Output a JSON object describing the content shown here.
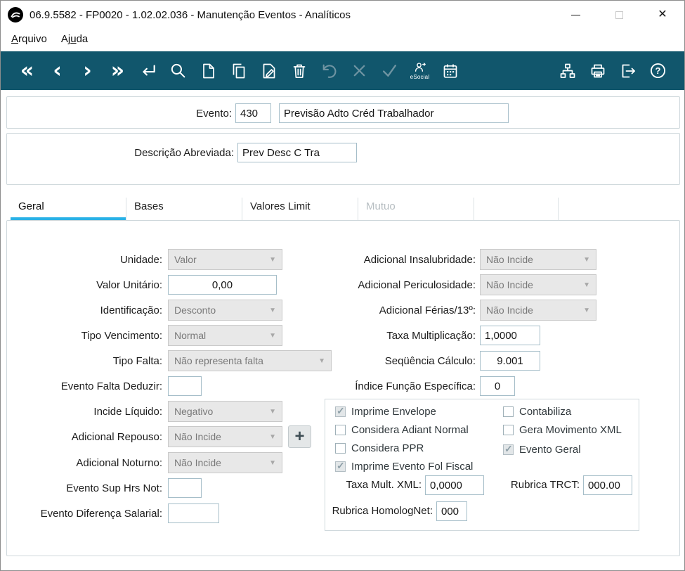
{
  "window": {
    "title": "06.9.5582 - FP0020 - 1.02.02.036 - Manutenção Eventos - Analíticos"
  },
  "menu": {
    "arquivo_key": "A",
    "arquivo_post": "rquivo",
    "ajuda_pre": "Aj",
    "ajuda_key": "u",
    "ajuda_post": "da"
  },
  "toolbar": {
    "esocial_label": "eSocial",
    "buttons_left": [
      "first-record",
      "previous-record",
      "next-record",
      "last-record",
      "confirm",
      "search",
      "new-document",
      "copy-document",
      "edit-document",
      "delete",
      "undo",
      "cancel",
      "ok",
      "esocial",
      "calendar"
    ],
    "buttons_right": [
      "structure-tree",
      "print",
      "exit",
      "help"
    ]
  },
  "header_fields": {
    "evento": {
      "label": "Evento:",
      "code": "430",
      "description": "Previsão Adto Créd Trabalhador"
    },
    "descricao_abreviada": {
      "label": "Descrição Abreviada:",
      "value": "Prev Desc C Tra"
    }
  },
  "tabs": {
    "geral": "Geral",
    "bases": "Bases",
    "valores_limit": "Valores Limit",
    "mutuo": "Mutuo"
  },
  "fields": {
    "unidade": {
      "label": "Unidade:",
      "value": "Valor"
    },
    "valor_unitario": {
      "label": "Valor Unitário:",
      "value": "0,00"
    },
    "identificacao": {
      "label": "Identificação:",
      "value": "Desconto"
    },
    "tipo_vencimento": {
      "label": "Tipo Vencimento:",
      "value": "Normal"
    },
    "tipo_falta": {
      "label": "Tipo Falta:",
      "value": "Não representa falta"
    },
    "evento_falta_deduzir": {
      "label": "Evento Falta Deduzir:",
      "value": ""
    },
    "incide_liquido": {
      "label": "Incide Líquido:",
      "value": "Negativo"
    },
    "adicional_repouso": {
      "label": "Adicional Repouso:",
      "value": "Não Incide"
    },
    "adicional_noturno": {
      "label": "Adicional Noturno:",
      "value": "Não Incide"
    },
    "evento_sup_hrs_not": {
      "label": "Evento Sup Hrs Not:",
      "value": ""
    },
    "evento_diferenca_salarial": {
      "label": "Evento Diferença Salarial:",
      "value": ""
    },
    "adicional_insalubridade": {
      "label": "Adicional Insalubridade:",
      "value": "Não Incide"
    },
    "adicional_periculosidade": {
      "label": "Adicional Periculosidade:",
      "value": "Não Incide"
    },
    "adicional_ferias_13": {
      "label": "Adicional Férias/13º:",
      "value": "Não Incide"
    },
    "taxa_multiplicacao": {
      "label": "Taxa Multiplicação:",
      "value": "1,0000"
    },
    "sequencia_calculo": {
      "label": "Seqüência Cálculo:",
      "value": "9.001"
    },
    "indice_funcao_especifica": {
      "label": "Índice Função Específica:",
      "value": "0"
    },
    "taxa_mult_xml": {
      "label": "Taxa Mult. XML:",
      "value": "0,0000"
    },
    "rubrica_trct": {
      "label": "Rubrica TRCT:",
      "value": "000.00"
    },
    "rubrica_homolognet": {
      "label": "Rubrica HomologNet:",
      "value": "000"
    }
  },
  "checkboxes": {
    "imprime_envelope": {
      "label": "Imprime Envelope",
      "checked": true
    },
    "considera_adiant_normal": {
      "label": "Considera Adiant Normal",
      "checked": false
    },
    "considera_ppr": {
      "label": "Considera PPR",
      "checked": false
    },
    "imprime_evento_fol_fiscal": {
      "label": "Imprime Evento Fol Fiscal",
      "checked": true
    },
    "contabiliza": {
      "label": "Contabiliza",
      "checked": false
    },
    "gera_movimento_xml": {
      "label": "Gera Movimento XML",
      "checked": false
    },
    "evento_geral": {
      "label": "Evento Geral",
      "checked": true
    }
  },
  "colors": {
    "toolbar_bg": "#11566c",
    "active_tab_underline": "#29b1e6"
  }
}
